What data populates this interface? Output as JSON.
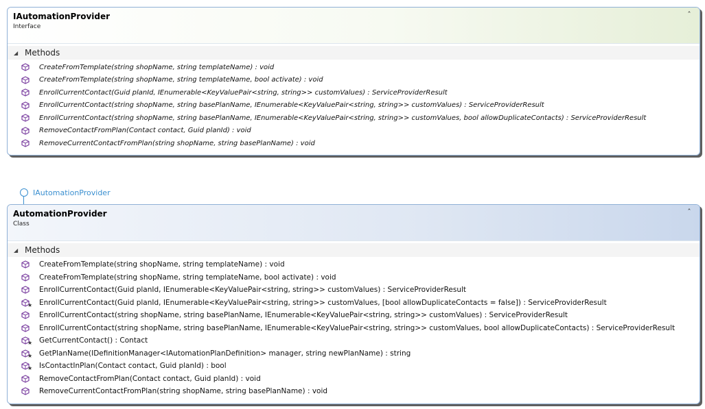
{
  "interface_box": {
    "title": "IAutomationProvider",
    "kind": "Interface",
    "collapse_glyph": "˄˄",
    "section_label": "Methods",
    "methods": [
      {
        "sig": "CreateFromTemplate(string shopName, string templateName) : void",
        "icon": "method-icon"
      },
      {
        "sig": "CreateFromTemplate(string shopName, string templateName, bool activate) : void",
        "icon": "method-icon"
      },
      {
        "sig": "EnrollCurrentContact(Guid planId, IEnumerable<KeyValuePair<string, string>> customValues) : ServiceProviderResult",
        "icon": "method-icon"
      },
      {
        "sig": "EnrollCurrentContact(string shopName, string basePlanName, IEnumerable<KeyValuePair<string, string>> customValues) : ServiceProviderResult",
        "icon": "method-icon"
      },
      {
        "sig": "EnrollCurrentContact(string shopName, string basePlanName, IEnumerable<KeyValuePair<string, string>> customValues, bool allowDuplicateContacts) : ServiceProviderResult",
        "icon": "method-icon"
      },
      {
        "sig": "RemoveContactFromPlan(Contact contact, Guid planId) : void",
        "icon": "method-icon"
      },
      {
        "sig": "RemoveCurrentContactFromPlan(string shopName, string basePlanName) : void",
        "icon": "method-icon"
      }
    ]
  },
  "lollipop": {
    "label": "IAutomationProvider"
  },
  "class_box": {
    "title": "AutomationProvider",
    "kind": "Class",
    "collapse_glyph": "˄˄",
    "section_label": "Methods",
    "methods": [
      {
        "sig": "CreateFromTemplate(string shopName, string templateName) : void",
        "icon": "method-icon",
        "star": false
      },
      {
        "sig": "CreateFromTemplate(string shopName, string templateName, bool activate) : void",
        "icon": "method-icon",
        "star": false
      },
      {
        "sig": "EnrollCurrentContact(Guid planId, IEnumerable<KeyValuePair<string, string>> customValues) : ServiceProviderResult",
        "icon": "method-icon",
        "star": false
      },
      {
        "sig": "EnrollCurrentContact(Guid planId, IEnumerable<KeyValuePair<string, string>> customValues, [bool allowDuplicateContacts = false]) : ServiceProviderResult",
        "icon": "method-icon",
        "star": true
      },
      {
        "sig": "EnrollCurrentContact(string shopName, string basePlanName, IEnumerable<KeyValuePair<string, string>> customValues) : ServiceProviderResult",
        "icon": "method-icon",
        "star": false
      },
      {
        "sig": "EnrollCurrentContact(string shopName, string basePlanName, IEnumerable<KeyValuePair<string, string>> customValues, bool allowDuplicateContacts) : ServiceProviderResult",
        "icon": "method-icon",
        "star": false
      },
      {
        "sig": "GetCurrentContact() : Contact",
        "icon": "method-icon",
        "star": true
      },
      {
        "sig": "GetPlanName(IDefinitionManager<IAutomationPlanDefinition> manager, string newPlanName) : string",
        "icon": "method-icon",
        "star": true
      },
      {
        "sig": "IsContactInPlan(Contact contact, Guid planId) : bool",
        "icon": "method-icon",
        "star": true
      },
      {
        "sig": "RemoveContactFromPlan(Contact contact, Guid planId) : void",
        "icon": "method-icon",
        "star": false
      },
      {
        "sig": "RemoveCurrentContactFromPlan(string shopName, string basePlanName) : void",
        "icon": "method-icon",
        "star": false
      }
    ]
  },
  "colors": {
    "method_icon": "#7b3fa0",
    "border": "#8fb0d6",
    "lollipop": "#3a8fd0"
  }
}
